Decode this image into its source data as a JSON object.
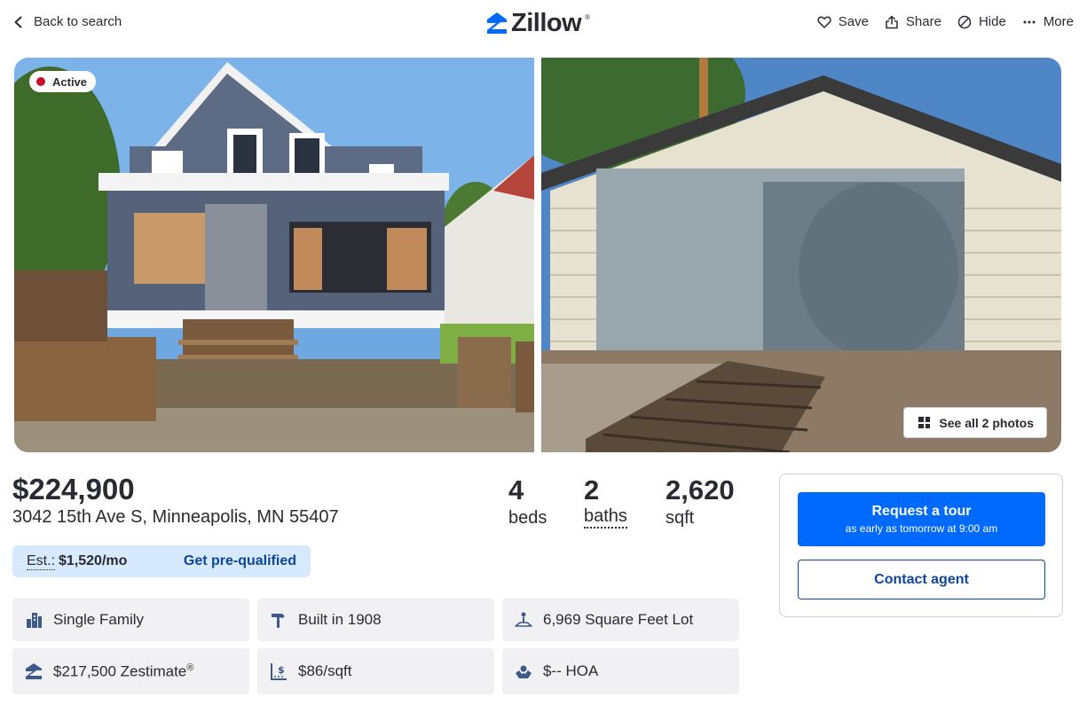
{
  "header": {
    "back_label": "Back to search",
    "logo_text": "Zillow",
    "logo_reg": "®",
    "actions": {
      "save": "Save",
      "share": "Share",
      "hide": "Hide",
      "more": "More"
    }
  },
  "photos": {
    "status_badge": "Active",
    "see_all_label": "See all 2 photos"
  },
  "listing": {
    "price": "$224,900",
    "address": "3042 15th Ave S, Minneapolis, MN 55407",
    "beds": {
      "value": "4",
      "label": "beds"
    },
    "baths": {
      "value": "2",
      "label": "baths"
    },
    "sqft": {
      "value": "2,620",
      "label": "sqft"
    },
    "estimate": {
      "label": "Est.:",
      "amount": "$1,520/mo",
      "cta": "Get pre-qualified"
    }
  },
  "highlights": {
    "type": "Single Family",
    "built": "Built in 1908",
    "lot": "6,969 Square Feet Lot",
    "zestimate": "$217,500 Zestimate",
    "zestimate_reg": "®",
    "price_per_sqft": "$86/sqft",
    "hoa": "$-- HOA"
  },
  "agent_card": {
    "tour_label": "Request a tour",
    "tour_sub": "as early as tomorrow at 9:00 am",
    "contact_label": "Contact agent"
  },
  "colors": {
    "brand_blue": "#006aff",
    "link_blue": "#0d4599",
    "estimate_bg": "#d7e9fc",
    "status_red": "#c8102e",
    "tile_bg": "#f1f1f4"
  }
}
